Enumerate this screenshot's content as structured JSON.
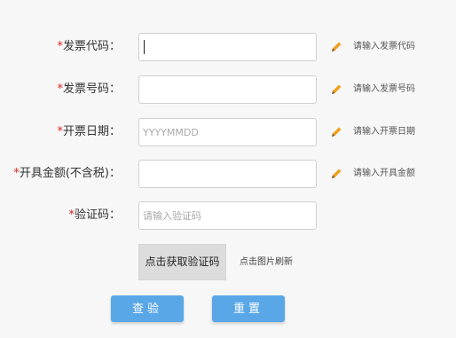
{
  "form": {
    "invoice_code": {
      "label": "发票代码：",
      "value": "",
      "hint": "请输入发票代码"
    },
    "invoice_number": {
      "label": "发票号码：",
      "value": "",
      "hint": "请输入发票号码"
    },
    "issue_date": {
      "label": "开票日期：",
      "value": "",
      "placeholder": "YYYYMMDD",
      "hint": "请输入开票日期"
    },
    "amount": {
      "label": "开具金额(不含税)：",
      "value": "",
      "hint": "请输入开具金额"
    },
    "captcha": {
      "label": "验证码：",
      "value": "",
      "placeholder": "请输入验证码"
    },
    "required_mark": "*"
  },
  "captcha_image": {
    "text": "点击获取验证码",
    "refresh_text": "点击图片刷新"
  },
  "buttons": {
    "verify": "查验",
    "reset": "重置"
  },
  "icons": {
    "edit": "pencil-icon"
  },
  "colors": {
    "required": "#e02020",
    "primary": "#5aa7e8",
    "pencil": "#f0a020"
  }
}
